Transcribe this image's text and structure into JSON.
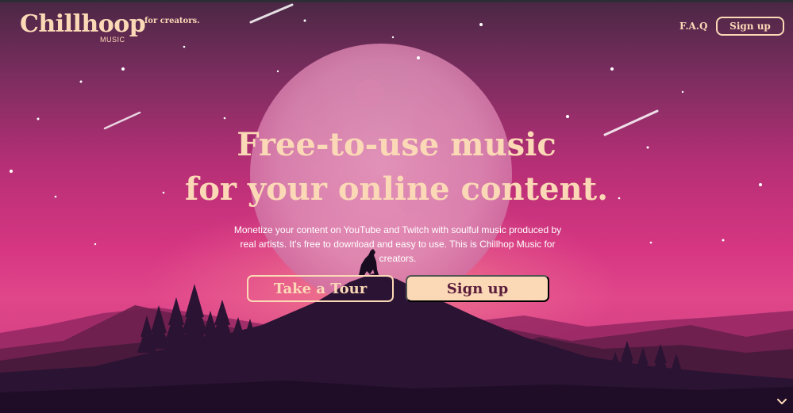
{
  "brand": {
    "name": "Chillhoop",
    "sub": "MUSIC",
    "tagline": "for creators."
  },
  "nav": {
    "faq": "F.A.Q",
    "signup": "Sign up"
  },
  "hero": {
    "title_line1": "Free-to-use music",
    "title_line2": "for your online content.",
    "description": "Monetize your content on YouTube and Twitch with soulful music produced by real artists. It's free to download and easy to use. This is Chillhop Music for creators."
  },
  "buttons": {
    "tour": "Take a Tour",
    "signup": "Sign up"
  },
  "icons": {
    "scroll": "chevron-down-icon"
  },
  "colors": {
    "accent": "#fcd9b6",
    "button_text": "#5a1d3c"
  }
}
